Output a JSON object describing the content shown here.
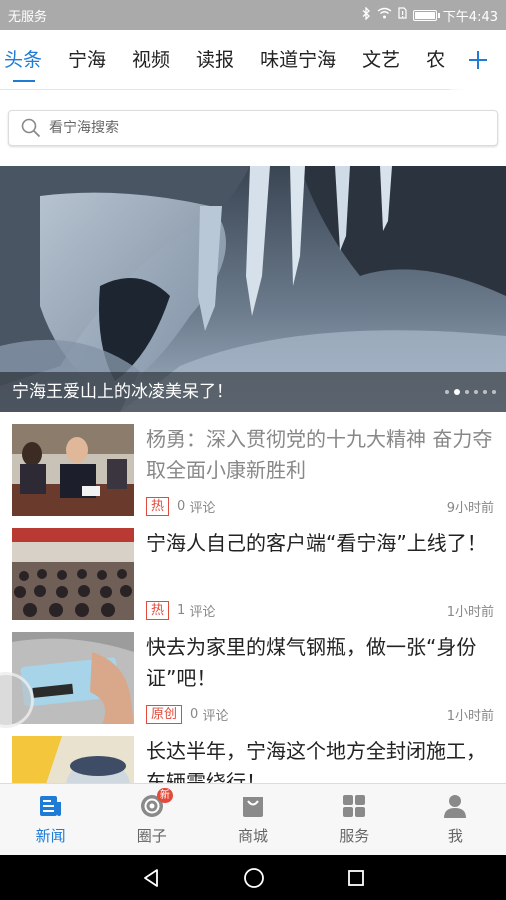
{
  "status_bar": {
    "carrier": "无服务",
    "time": "下午4:43",
    "battery_level": 0.9
  },
  "tabs": {
    "items": [
      "头条",
      "宁海",
      "视频",
      "读报",
      "味道宁海",
      "文艺",
      "农"
    ],
    "active_index": 0,
    "add_icon": "plus-icon"
  },
  "search": {
    "placeholder": "看宁海搜索",
    "icon": "search-icon"
  },
  "banner": {
    "caption": "宁海王爱山上的冰凌美呆了！",
    "slide_count": 6,
    "active_slide": 1
  },
  "news": [
    {
      "title": "杨勇：深入贯彻党的十九大精神 奋力夺取全面小康新胜利",
      "tag": "热",
      "comments": "0",
      "comment_label": "评论",
      "time": "9小时前",
      "read": true
    },
    {
      "title": "宁海人自己的客户端“看宁海”上线了！",
      "tag": "热",
      "comments": "1",
      "comment_label": "评论",
      "time": "1小时前",
      "read": false
    },
    {
      "title": "快去为家里的煤气钢瓶，做一张“身份证”吧！",
      "tag": "原创",
      "comments": "0",
      "comment_label": "评论",
      "time": "1小时前",
      "read": false
    },
    {
      "title": "长达半年，宁海这个地方全封闭施工，车辆需绕行！",
      "tag": "",
      "comments": "",
      "comment_label": "",
      "time": "",
      "read": false
    }
  ],
  "bottom_nav": {
    "items": [
      {
        "label": "新闻",
        "icon": "news-icon"
      },
      {
        "label": "圈子",
        "icon": "circle-icon",
        "badge": "新"
      },
      {
        "label": "商城",
        "icon": "shopping-bag-icon"
      },
      {
        "label": "服务",
        "icon": "grid-icon"
      },
      {
        "label": "我",
        "icon": "user-icon"
      }
    ],
    "active_index": 0
  },
  "colors": {
    "accent": "#1e7cd6",
    "tag_red": "#e24b3b"
  }
}
